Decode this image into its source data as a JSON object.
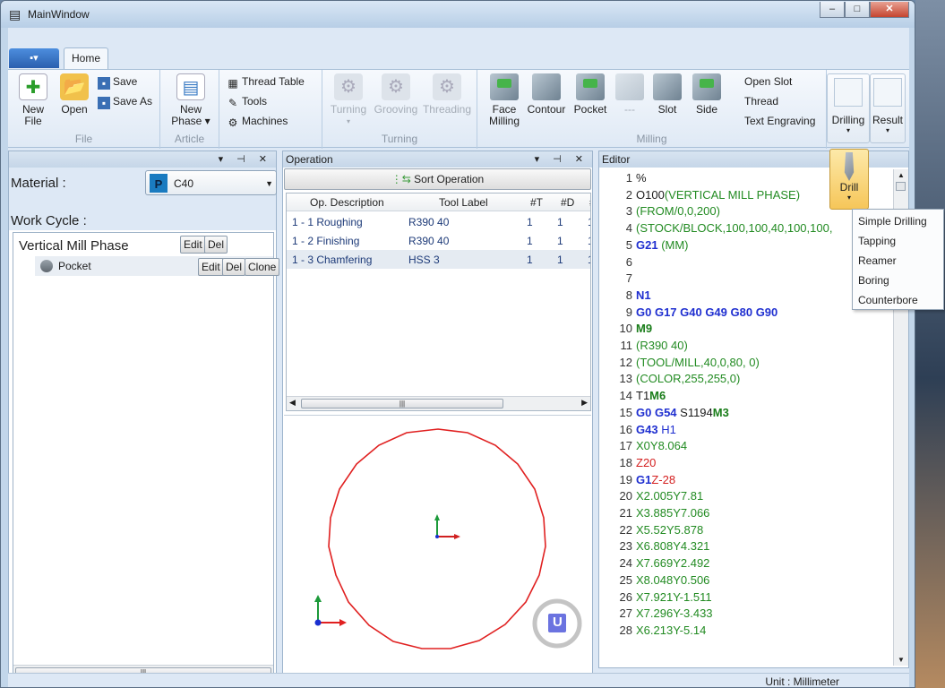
{
  "window": {
    "title": "MainWindow",
    "min": "–",
    "max": "□",
    "close": "✕"
  },
  "ribbon": {
    "app_menu": "▪▾",
    "tab_home": "Home",
    "file": {
      "new": "New File",
      "new_l1": "New",
      "new_l2": "File",
      "open": "Open",
      "save": "Save",
      "save_as": "Save As",
      "label": "File"
    },
    "article": {
      "new_phase_l1": "New",
      "new_phase_l2": "Phase ▾",
      "label": "Article"
    },
    "misc": {
      "thread_table": "Thread Table",
      "tools": "Tools",
      "machines": "Machines"
    },
    "turning": {
      "turning": "Turning",
      "grooving": "Grooving",
      "threading": "Threading",
      "label": "Turning"
    },
    "milling": {
      "face_l1": "Face",
      "face_l2": "Milling",
      "contour": "Contour",
      "pocket": "Pocket",
      "dash": "---",
      "slot": "Slot",
      "side": "Side",
      "open_slot": "Open Slot",
      "thread": "Thread",
      "text_engraving": "Text Engraving",
      "label": "Milling"
    },
    "drilling": "Drilling",
    "result": "Result"
  },
  "left": {
    "material_label": "Material :",
    "iso": "P",
    "material_value": "C40",
    "work_cycle_label": "Work Cycle :",
    "phase": {
      "label": "Vertical Mill Phase",
      "edit": "Edit",
      "del": "Del"
    },
    "op": {
      "label": "Pocket",
      "edit": "Edit",
      "del": "Del",
      "clone": "Clone"
    },
    "scroll": "|||"
  },
  "operation": {
    "title": "Operation",
    "sort": "Sort Operation",
    "columns": [
      "Op. Description",
      "Tool Label",
      "#T",
      "#D",
      "#"
    ],
    "rows": [
      {
        "desc": "1 - 1 Roughing",
        "tool": "R390 40",
        "t": "1",
        "d": "1",
        "x": "1"
      },
      {
        "desc": "1 - 2 Finishing",
        "tool": "R390 40",
        "t": "1",
        "d": "1",
        "x": "1"
      },
      {
        "desc": "1 - 3 Chamfering",
        "tool": "HSS 3",
        "t": "1",
        "d": "1",
        "x": "1"
      }
    ],
    "scroll": "|||",
    "view_badge": "U"
  },
  "editor": {
    "title": "Editor",
    "lines": [
      {
        "n": "1",
        "parts": [
          [
            "%",
            "#1b1b1b",
            false
          ]
        ]
      },
      {
        "n": "2",
        "parts": [
          [
            "O100",
            "#1b1b1b",
            false
          ],
          [
            "(VERTICAL MILL PHASE)",
            "#228b22",
            false
          ]
        ]
      },
      {
        "n": "3",
        "parts": [
          [
            "(FROM/0,0,200)",
            "#228b22",
            false
          ]
        ]
      },
      {
        "n": "4",
        "parts": [
          [
            "(STOCK/BLOCK,100,100,40,100,100,",
            "#228b22",
            false
          ]
        ]
      },
      {
        "n": "5",
        "parts": [
          [
            "G21",
            "#1f2fd0",
            true
          ],
          [
            " (MM)",
            "#228b22",
            false
          ]
        ]
      },
      {
        "n": "6",
        "parts": []
      },
      {
        "n": "7",
        "parts": []
      },
      {
        "n": "8",
        "parts": [
          [
            "N1",
            "#1f2fd0",
            true
          ]
        ]
      },
      {
        "n": "9",
        "parts": [
          [
            "G0 G17 G40 G49 G80 G90",
            "#1f2fd0",
            true
          ]
        ]
      },
      {
        "n": "10",
        "parts": [
          [
            "M9",
            "#1a7d1a",
            true
          ]
        ]
      },
      {
        "n": "11",
        "parts": [
          [
            "(R390 40)",
            "#228b22",
            false
          ]
        ]
      },
      {
        "n": "12",
        "parts": [
          [
            "(TOOL/MILL,40,0,80, 0)",
            "#228b22",
            false
          ]
        ]
      },
      {
        "n": "13",
        "parts": [
          [
            "(COLOR,255,255,0)",
            "#228b22",
            false
          ]
        ]
      },
      {
        "n": "14",
        "parts": [
          [
            "T1",
            "#1b1b1b",
            false
          ],
          [
            "M6",
            "#1a7d1a",
            true
          ]
        ]
      },
      {
        "n": "15",
        "parts": [
          [
            "G0 G54",
            "#1f2fd0",
            true
          ],
          [
            " S1194",
            "#1b1b1b",
            false
          ],
          [
            "M3",
            "#1a7d1a",
            true
          ]
        ]
      },
      {
        "n": "16",
        "parts": [
          [
            "G43",
            "#1f2fd0",
            true
          ],
          [
            " H1",
            "#1f2fd0",
            false
          ]
        ]
      },
      {
        "n": "17",
        "parts": [
          [
            "X0Y8.064",
            "#228b22",
            false
          ]
        ]
      },
      {
        "n": "18",
        "parts": [
          [
            "Z20",
            "#d42020",
            false
          ]
        ]
      },
      {
        "n": "19",
        "parts": [
          [
            "G1",
            "#1f2fd0",
            true
          ],
          [
            "Z-28",
            "#d42020",
            false
          ]
        ]
      },
      {
        "n": "20",
        "parts": [
          [
            "X2.005Y7.81",
            "#228b22",
            false
          ]
        ]
      },
      {
        "n": "21",
        "parts": [
          [
            "X3.885Y7.066",
            "#228b22",
            false
          ]
        ]
      },
      {
        "n": "22",
        "parts": [
          [
            "X5.52Y5.878",
            "#228b22",
            false
          ]
        ]
      },
      {
        "n": "23",
        "parts": [
          [
            "X6.808Y4.321",
            "#228b22",
            false
          ]
        ]
      },
      {
        "n": "24",
        "parts": [
          [
            "X7.669Y2.492",
            "#228b22",
            false
          ]
        ]
      },
      {
        "n": "25",
        "parts": [
          [
            "X8.048Y0.506",
            "#228b22",
            false
          ]
        ]
      },
      {
        "n": "26",
        "parts": [
          [
            "X7.921Y-1.511",
            "#228b22",
            false
          ]
        ]
      },
      {
        "n": "27",
        "parts": [
          [
            "X7.296Y-3.433",
            "#228b22",
            false
          ]
        ]
      },
      {
        "n": "28",
        "parts": [
          [
            "X6.213Y-5.14",
            "#228b22",
            false
          ]
        ]
      }
    ]
  },
  "drill_popup": {
    "label": "Drill",
    "arrow": "▾"
  },
  "drill_menu": [
    "Simple Drilling",
    "Tapping",
    "Reamer",
    "Boring",
    "Counterbore"
  ],
  "panel_controls": "▾ ⊣ ✕",
  "status": {
    "unit": "Unit : Millimeter"
  }
}
